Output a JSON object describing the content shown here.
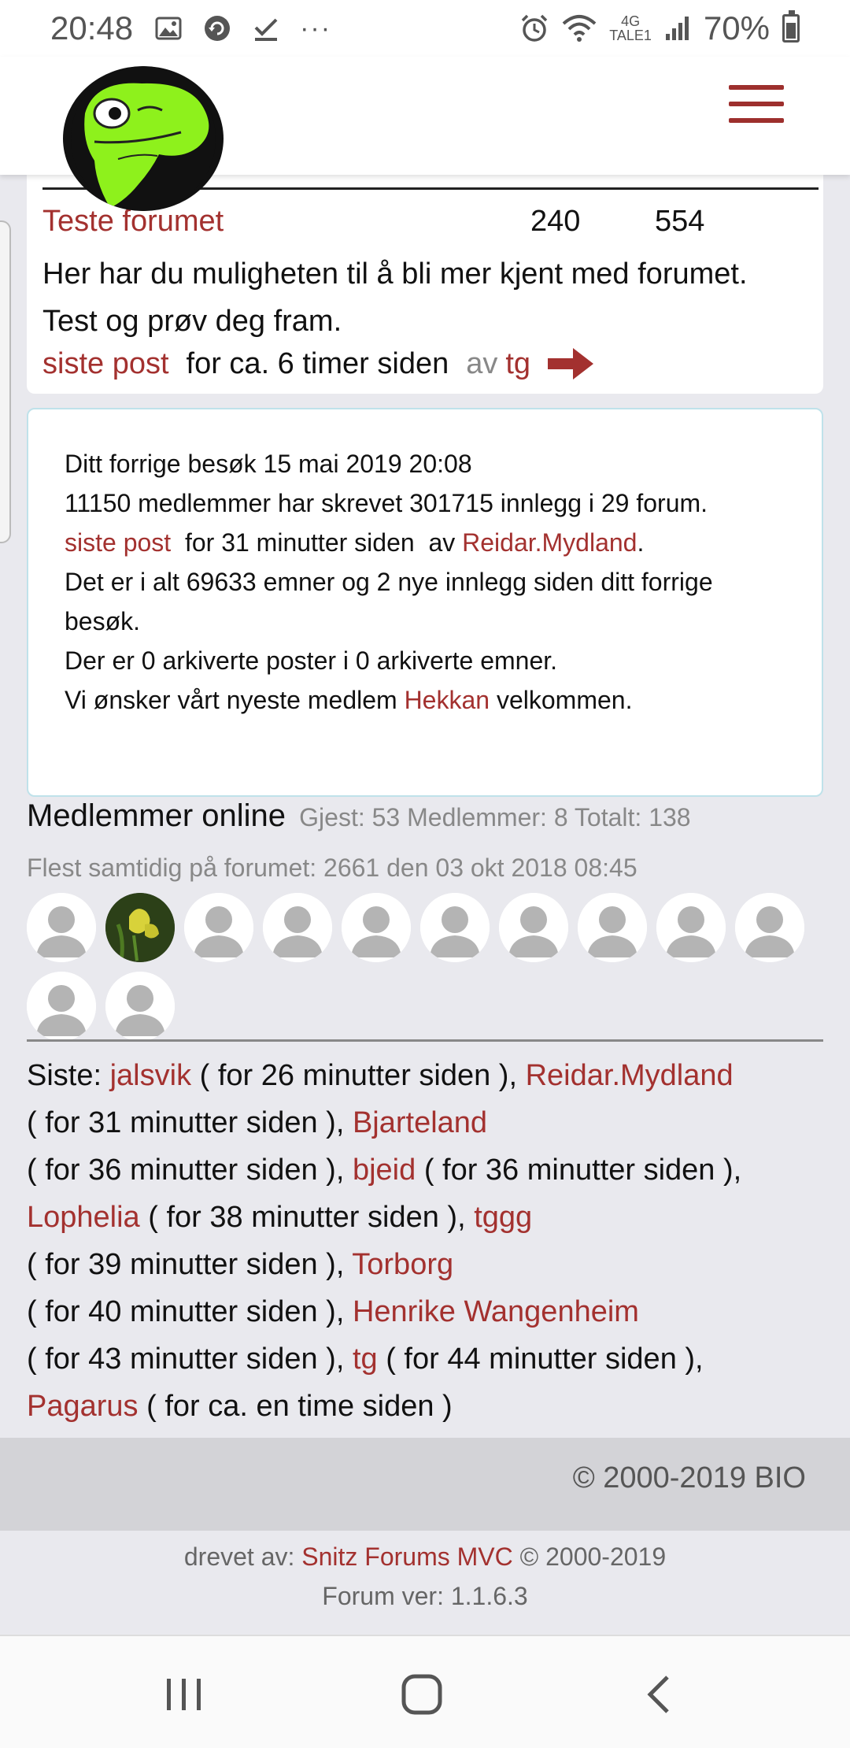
{
  "status_bar": {
    "time": "20:48",
    "ellipsis": "···",
    "network_top": "4G",
    "network_bottom": "TALE1",
    "battery": "70%"
  },
  "header": {
    "logo_icon": "frog-logo-icon",
    "menu_icon": "hamburger-menu-icon",
    "accent_color": "#9d2f2d"
  },
  "forum": {
    "title": "Teste forumet",
    "topics": "240",
    "posts": "554",
    "description": "Her har du muligheten til å bli mer kjent med forumet. Test og prøv deg fram.",
    "last_post_label": "siste post",
    "last_post_time": "for ca. 6 timer siden",
    "by_label": "av",
    "last_post_author": "tg"
  },
  "stats": {
    "prev_visit": "Ditt forrige besøk  15 mai 2019 20:08",
    "members_line": "11150 medlemmer har skrevet 301715 innlegg i 29 forum.",
    "last_post_label": "siste post",
    "last_post_time": "for 31 minutter siden",
    "by_label": "av",
    "last_post_author": "Reidar.Mydland",
    "topics_line": "Det er i alt 69633 emner og 2 nye innlegg siden ditt forrige besøk.",
    "archive_line": "Der er 0 arkiverte poster i 0 arkiverte emner.",
    "welcome_pre": "Vi ønsker vårt nyeste medlem",
    "newest_member": "Hekkan",
    "welcome_post": "velkommen."
  },
  "online": {
    "title": "Medlemmer online",
    "summary": "Gjest: 53 Medlemmer: 8 Totalt: 138",
    "peak": "Flest samtidig på forumet: 2661 den 03 okt 2018 08:45"
  },
  "recent": {
    "label": "Siste:",
    "users": [
      {
        "name": "jalsvik",
        "time": "( for 26 minutter siden ),"
      },
      {
        "name": "Reidar.Mydland",
        "time": "( for 31 minutter siden ),"
      },
      {
        "name": "Bjarteland",
        "time": "( for 36 minutter siden ),"
      },
      {
        "name": "bjeid",
        "time": "( for 36 minutter siden ),"
      },
      {
        "name": "Lophelia",
        "time": "( for 38 minutter siden ),"
      },
      {
        "name": "tggg",
        "time": "( for 39 minutter siden ),"
      },
      {
        "name": "Torborg",
        "time": "( for 40 minutter siden ),"
      },
      {
        "name": "Henrike Wangenheim",
        "time": "( for 43 minutter siden ),"
      },
      {
        "name": "tg",
        "time": "( for 44 minutter siden ),"
      },
      {
        "name": "Pagarus",
        "time": "( for ca. en time siden )"
      }
    ]
  },
  "footer": {
    "copyright": "© 2000-2019 BIO",
    "powered_label": "drevet av:",
    "powered_link": "Snitz Forums MVC",
    "powered_years": "© 2000-2019",
    "version": "Forum ver: 1.1.6.3"
  }
}
